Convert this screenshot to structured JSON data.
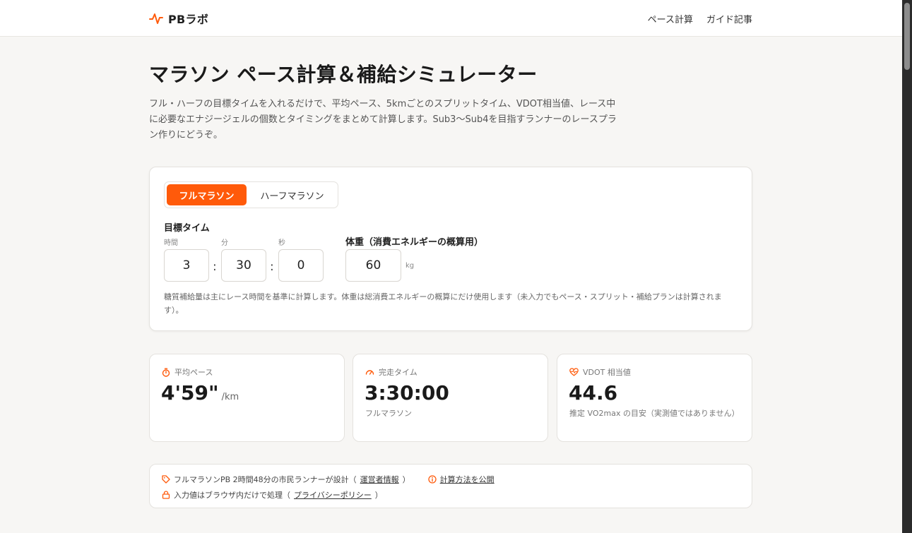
{
  "site": {
    "logo": "PBラボ",
    "nav": [
      "ペース計算",
      "ガイド記事"
    ]
  },
  "page": {
    "title": "マラソン ペース計算＆補給シミュレーター",
    "intro": "フル・ハーフの目標タイムを入れるだけで、平均ペース、5kmごとのスプリットタイム、VDOT相当値、レース中に必要なエナジージェルの個数とタイミングをまとめて計算します。Sub3〜Sub4を目指すランナーのレースプラン作りにどうぞ。"
  },
  "calculator": {
    "tabs": [
      "フルマラソン",
      "ハーフマラソン"
    ],
    "target_time_label": "目標タイム",
    "hours_label": "時間",
    "minutes_label": "分",
    "seconds_label": "秒",
    "hours_value": "3",
    "minutes_value": "30",
    "seconds_value": "0",
    "colon": ":",
    "weight_label": "体重（消費エネルギーの概算用）",
    "weight_value": "60",
    "weight_unit": "kg",
    "note": "糖質補給量は主にレース時間を基準に計算します。体重は総消費エネルギーの概算にだけ使用します（未入力でもペース・スプリット・補給プランは計算されます）。"
  },
  "stats": {
    "pace_label": "平均ペース",
    "pace_value": "4'59\"",
    "pace_unit": "/km",
    "finish_label": "完走タイム",
    "finish_value": "3:30:00",
    "finish_sub": "フルマラソン",
    "vdot_label": "VDOT 相当値",
    "vdot_value": "44.6",
    "vdot_sub": "推定 VO2max の目安（実測値ではありません）"
  },
  "trust": {
    "row1_text": "フルマラソンPB 2時間48分の市民ランナーが設計（",
    "row1_link": "運営者情報",
    "row1_close": "）",
    "method_link": "計算方法を公開",
    "row2_text": "入力値はブラウザ内だけで処理（",
    "row2_link": "プライバシーポリシー",
    "row2_close": "）"
  },
  "colors": {
    "accent": "#ff5a0a",
    "background": "#f7f6f4"
  }
}
